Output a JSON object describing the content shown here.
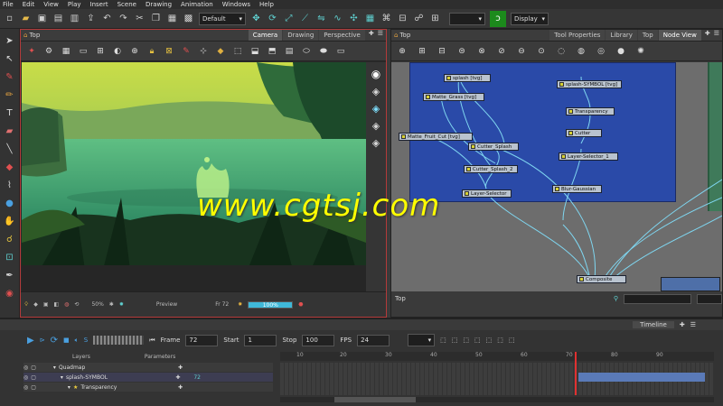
{
  "menu": [
    "File",
    "Edit",
    "View",
    "Play",
    "Insert",
    "Scene",
    "Drawing",
    "Animation",
    "Windows",
    "Help"
  ],
  "toolbar": {
    "workspace_select": "Default",
    "display_select": "Display"
  },
  "camera_panel": {
    "title": "Top",
    "tabs": [
      "Camera",
      "Drawing",
      "Perspective"
    ],
    "active_tab": "Camera",
    "footer": {
      "zoom": "50%",
      "preview": "Preview",
      "frame": "Fr 72",
      "progress_label": "100%",
      "progress_value": 1.0
    }
  },
  "node_panel": {
    "title": "Top",
    "tabs": [
      "Tool Properties",
      "Library",
      "Top",
      "Node View"
    ],
    "active_tab": "Node View",
    "footer_label": "Top",
    "nodes": [
      {
        "label": "splash [tvg]"
      },
      {
        "label": "splash-SYMBOL [tvg]"
      },
      {
        "label": "Matte_Grass [tvg]"
      },
      {
        "label": "Transparency"
      },
      {
        "label": "Matte_Fruit_Cut [tvg]"
      },
      {
        "label": "Cutter_Splash"
      },
      {
        "label": "Cutter"
      },
      {
        "label": "Layer-Selector_1"
      },
      {
        "label": "Cutter_Splash_2"
      },
      {
        "label": "Layer-Selector"
      },
      {
        "label": "Blur-Gaussian"
      },
      {
        "label": "Composite"
      }
    ]
  },
  "timeline": {
    "header": "Timeline",
    "frame_label": "Frame",
    "frame_value": "72",
    "start_label": "Start",
    "start_value": "1",
    "stop_label": "Stop",
    "stop_value": "100",
    "fps_label": "FPS",
    "fps_value": "24",
    "layers_label": "Layers",
    "parameters_label": "Parameters",
    "layers": [
      {
        "name": "Quadmap",
        "value": ""
      },
      {
        "name": "splash-SYMBOL",
        "value": "72"
      },
      {
        "name": "Transparency",
        "value": ""
      }
    ],
    "ruler": [
      "10",
      "20",
      "30",
      "40",
      "50",
      "60",
      "70",
      "80",
      "90"
    ]
  },
  "watermark": "www.cgtsj.com"
}
